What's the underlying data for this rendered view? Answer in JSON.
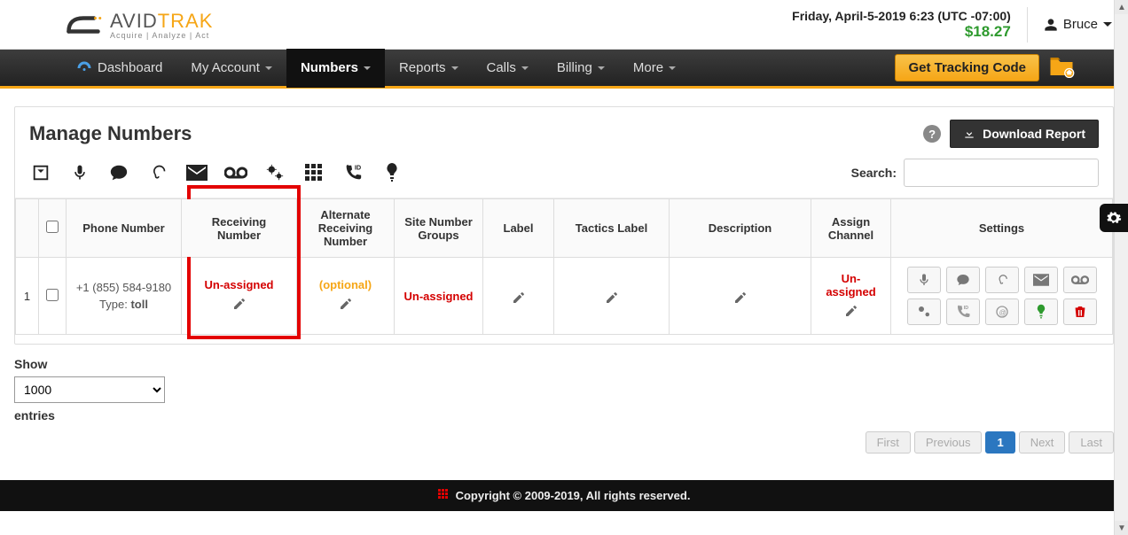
{
  "header": {
    "brand_part1": "AVID",
    "brand_part2": "TRAK",
    "tagline": "Acquire | Analyze | Act",
    "datetime": "Friday, April-5-2019 6:23 (UTC -07:00)",
    "balance": "$18.27",
    "user_name": "Bruce"
  },
  "nav": {
    "dashboard": "Dashboard",
    "my_account": "My Account",
    "numbers": "Numbers",
    "reports": "Reports",
    "calls": "Calls",
    "billing": "Billing",
    "more": "More",
    "tracking_btn": "Get Tracking Code"
  },
  "panel": {
    "title": "Manage Numbers",
    "download_btn": "Download Report",
    "search_label": "Search:",
    "search_value": ""
  },
  "columns": {
    "phone": "Phone Number",
    "receiving": "Receiving Number",
    "alternate": "Alternate Receiving Number",
    "site_groups": "Site Number Groups",
    "label": "Label",
    "tactics": "Tactics Label",
    "description": "Description",
    "channel": "Assign Channel",
    "settings": "Settings"
  },
  "rows": [
    {
      "idx": "1",
      "phone": "+1 (855) 584-9180",
      "type_label": "Type: ",
      "type_value": "toll",
      "receiving": "Un-assigned",
      "alternate": "(optional)",
      "site_groups": "Un-assigned",
      "label": "",
      "tactics": "",
      "description": "",
      "channel": "Un-assigned"
    }
  ],
  "pager": {
    "show_label": "Show",
    "entries_label": "entries",
    "selected": "1000",
    "first": "First",
    "previous": "Previous",
    "page": "1",
    "next": "Next",
    "last": "Last"
  },
  "footer": {
    "text": "Copyright © 2009-2019, All rights reserved."
  }
}
